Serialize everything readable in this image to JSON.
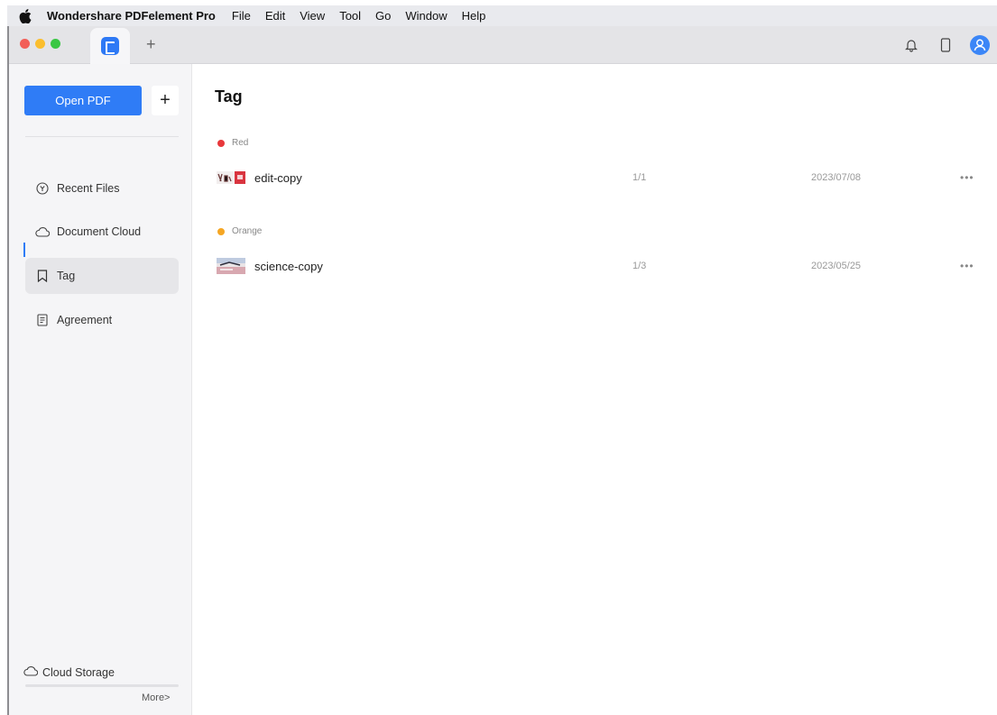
{
  "menubar": {
    "app_name": "Wondershare PDFelement Pro",
    "items": [
      "File",
      "Edit",
      "View",
      "Tool",
      "Go",
      "Window",
      "Help"
    ]
  },
  "titlebar": {
    "traffic_colors": [
      "#f25f58",
      "#fbbe2e",
      "#3ac744"
    ],
    "new_tab_label": "+",
    "right_icons": [
      "bell-icon",
      "phone-icon",
      "user-avatar-icon"
    ],
    "accent": "#2f7cf6"
  },
  "sidebar": {
    "open_pdf_label": "Open PDF",
    "add_label": "+",
    "items": [
      {
        "label": "Recent Files",
        "icon": "clock-icon"
      },
      {
        "label": "Document Cloud",
        "icon": "cloud-icon"
      },
      {
        "label": "Tag",
        "icon": "bookmark-icon"
      },
      {
        "label": "Agreement",
        "icon": "document-icon"
      }
    ],
    "active_item": "Tag",
    "cloud_storage_label": "Cloud Storage",
    "more_label": "More>"
  },
  "main": {
    "title": "Tag",
    "groups": [
      {
        "tag": "Red",
        "color": "#e8383b",
        "files": [
          {
            "name": "edit-copy",
            "pages": "1/1",
            "date": "2023/07/08",
            "more": "•••"
          }
        ]
      },
      {
        "tag": "Orange",
        "color": "#f5a623",
        "files": [
          {
            "name": "science-copy",
            "pages": "1/3",
            "date": "2023/05/25",
            "more": "•••"
          }
        ]
      }
    ]
  }
}
